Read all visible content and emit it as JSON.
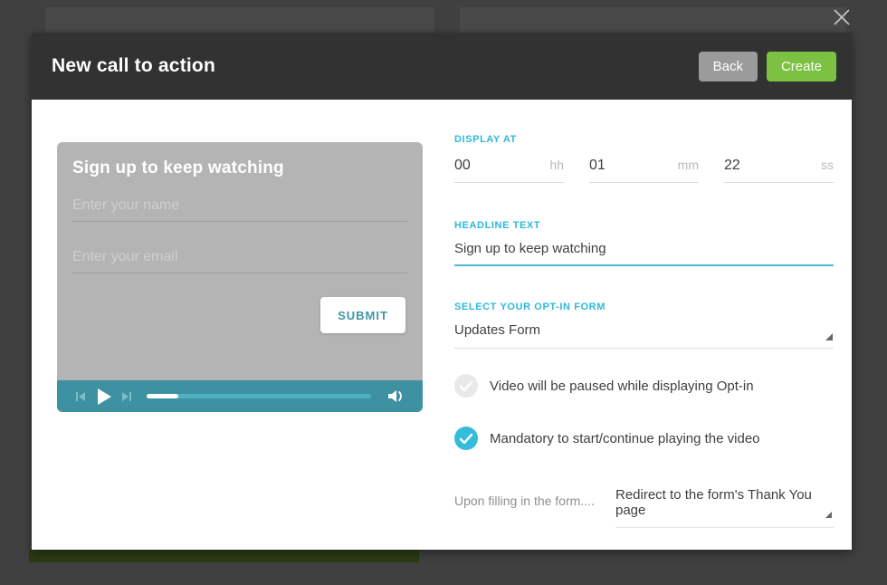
{
  "overlay": {
    "close_icon": "close-x"
  },
  "modal": {
    "title": "New call to action",
    "back_label": "Back",
    "create_label": "Create"
  },
  "preview": {
    "headline": "Sign up to keep watching",
    "name_placeholder": "Enter your name",
    "email_placeholder": "Enter your email",
    "submit_label": "SUBMIT",
    "player": {
      "progress_fraction": 0.14,
      "icons": [
        "skip-previous",
        "play",
        "skip-next",
        "volume"
      ]
    }
  },
  "form": {
    "display_at": {
      "label": "DISPLAY AT",
      "fields": [
        {
          "value": "00",
          "unit": "hh"
        },
        {
          "value": "01",
          "unit": "mm"
        },
        {
          "value": "22",
          "unit": "ss"
        }
      ]
    },
    "headline": {
      "label": "HEADLINE TEXT",
      "value": "Sign up to keep watching"
    },
    "optin": {
      "label": "SELECT YOUR OPT-IN FORM",
      "value": "Updates Form"
    },
    "checkboxes": [
      {
        "label": "Video will be paused while displaying Opt-in",
        "checked": false
      },
      {
        "label": "Mandatory to start/continue playing the video",
        "checked": true
      }
    ],
    "upon_filling": {
      "label": "Upon filling in the form....",
      "value": "Redirect to the form's Thank You page"
    }
  },
  "colors": {
    "accent_cyan": "#2db8da",
    "accent_green": "#7cc142",
    "player_teal": "#3d91a1",
    "checked_cyan": "#36bcdb",
    "header_dark": "#323232",
    "back_gray": "#9b9b9b",
    "card_gray": "#b4b4b4",
    "overlay_bg": "#404040"
  }
}
